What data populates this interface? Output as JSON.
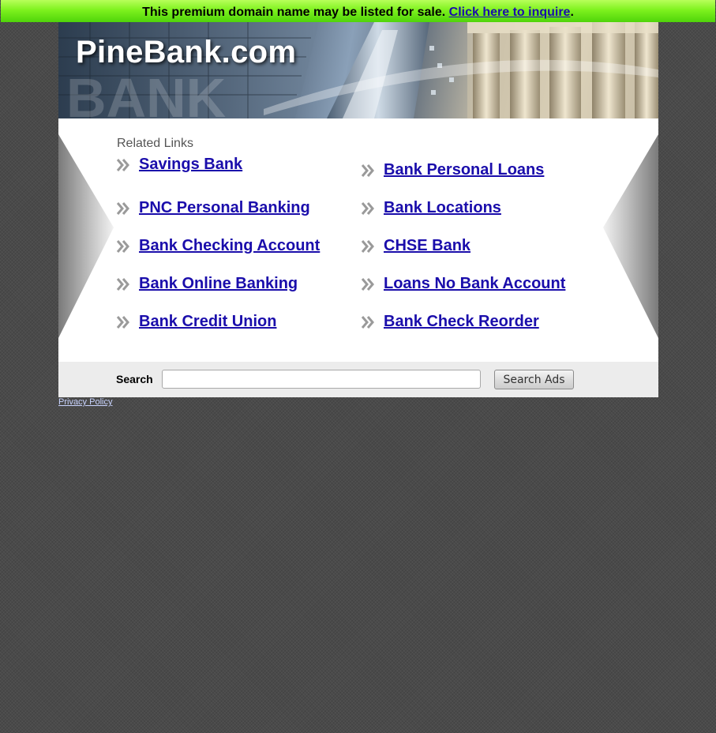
{
  "banner": {
    "text": "This premium domain name may be listed for sale.",
    "link_label": "Click here to inquire",
    "trailing": "."
  },
  "header": {
    "site_title": "PineBank.com"
  },
  "related": {
    "label": "Related Links",
    "left_links": [
      {
        "label": "Savings Bank",
        "icon": "double-chevron-right-icon"
      },
      {
        "label": "PNC Personal Banking",
        "icon": "double-chevron-right-icon"
      },
      {
        "label": "Bank Checking Account",
        "icon": "double-chevron-right-icon"
      },
      {
        "label": "Bank Online Banking",
        "icon": "double-chevron-right-icon"
      },
      {
        "label": "Bank Credit Union",
        "icon": "double-chevron-right-icon"
      }
    ],
    "right_links": [
      {
        "label": "Bank Personal Loans",
        "icon": "double-chevron-right-icon"
      },
      {
        "label": "Bank Locations",
        "icon": "double-chevron-right-icon"
      },
      {
        "label": "CHSE Bank",
        "icon": "double-chevron-right-icon"
      },
      {
        "label": "Loans No Bank Account",
        "icon": "double-chevron-right-icon"
      },
      {
        "label": "Bank Check Reorder",
        "icon": "double-chevron-right-icon"
      }
    ]
  },
  "search": {
    "label": "Search",
    "value": "",
    "button_label": "Search Ads"
  },
  "footer": {
    "privacy_label": "Privacy Policy"
  },
  "colors": {
    "banner_green": "#7ef21e",
    "link": "#1a0dab",
    "page_background": "#4a4a4a"
  }
}
